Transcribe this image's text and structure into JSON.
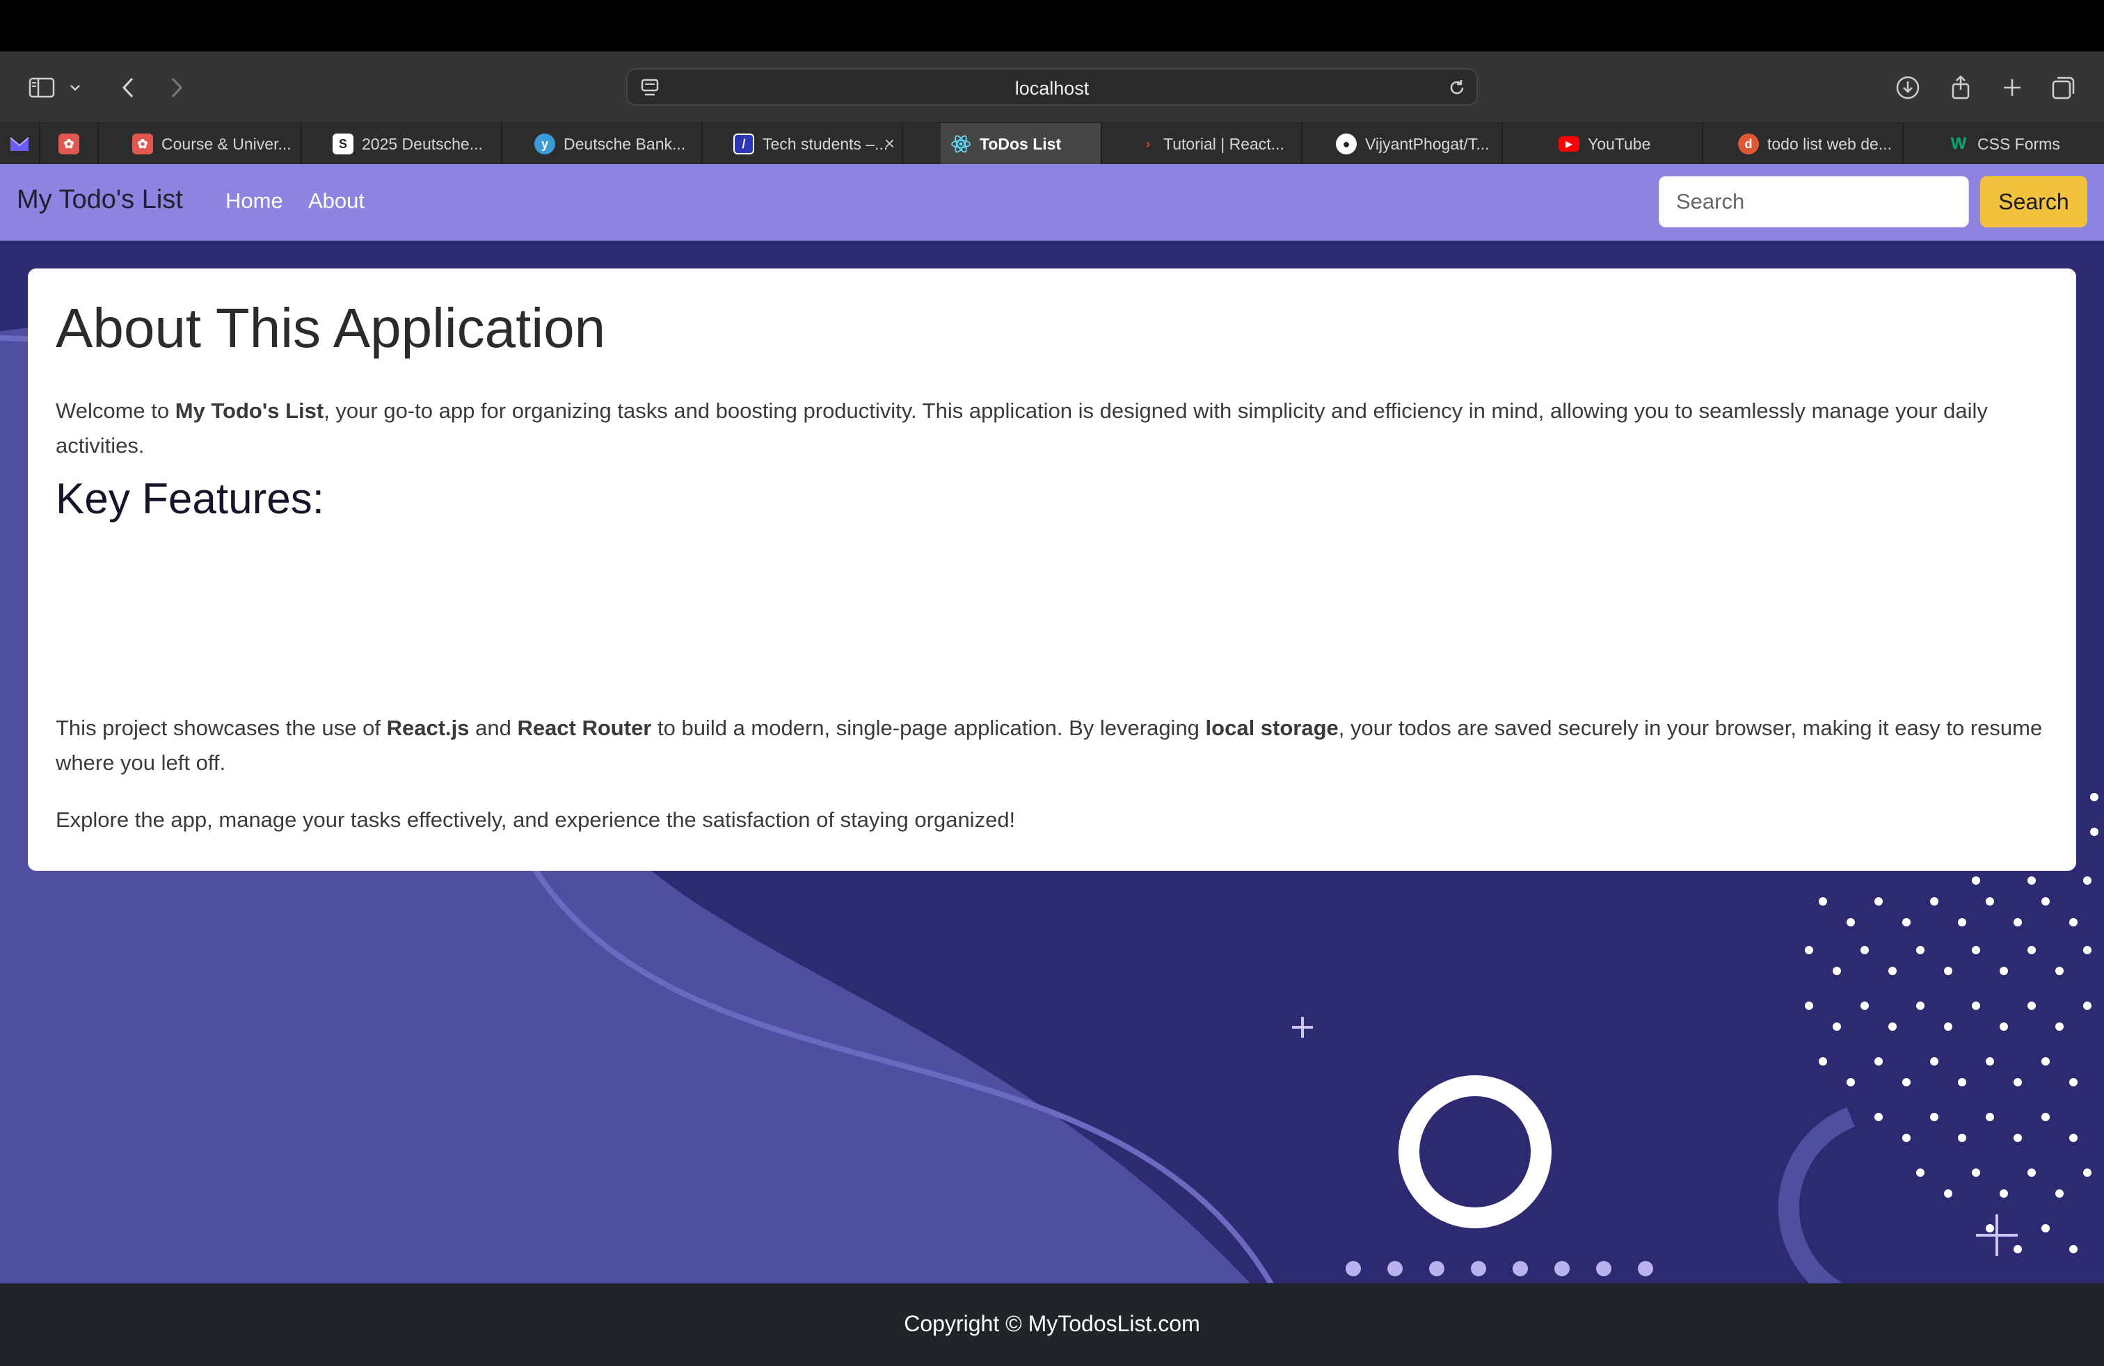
{
  "browser": {
    "url": "localhost",
    "tabs": [
      {
        "label": "",
        "favicon": "mail-icon",
        "color": "#6b5cff",
        "active": false
      },
      {
        "label": "",
        "favicon": "flower-icon",
        "color": "#e0584f",
        "active": false
      },
      {
        "label": "Course & Univer...",
        "favicon": "flower-icon",
        "color": "#e0584f",
        "active": false
      },
      {
        "label": "2025 Deutsche...",
        "favicon": "swirl-icon",
        "color": "#ffffff",
        "active": false
      },
      {
        "label": "Deutsche Bank...",
        "favicon": "bank-icon",
        "color": "#3a9bd9",
        "active": false
      },
      {
        "label": "Tech students –...",
        "favicon": "slash-box-icon",
        "color": "#2d36b8",
        "active": false
      },
      {
        "label": "ToDos List",
        "favicon": "react-icon",
        "color": "#61dafb",
        "active": true
      },
      {
        "label": "Tutorial | React...",
        "favicon": "chevron-right-icon",
        "color": "#e0463a",
        "active": false
      },
      {
        "label": "VijyantPhogat/T...",
        "favicon": "github-icon",
        "color": "#ffffff",
        "active": false
      },
      {
        "label": "YouTube",
        "favicon": "youtube-icon",
        "color": "#ff0000",
        "active": false
      },
      {
        "label": "todo list web de...",
        "favicon": "duckduckgo-icon",
        "color": "#de5833",
        "active": false
      },
      {
        "label": "CSS Forms",
        "favicon": "w3-icon",
        "color": "#04aa6d",
        "active": false
      }
    ]
  },
  "navbar": {
    "brand": "My Todo's List",
    "links": [
      "Home",
      "About"
    ],
    "search_placeholder": "Search",
    "search_button": "Search"
  },
  "about": {
    "title": "About This Application",
    "intro_prefix": "Welcome to ",
    "intro_bold": "My Todo's List",
    "intro_suffix": ", your go-to app for organizing tasks and boosting productivity. This application is designed with simplicity and efficiency in mind, allowing you to seamlessly manage your daily activities.",
    "features_title": "Key Features:",
    "tech_p1": "This project showcases the use of ",
    "tech_b1": "React.js",
    "tech_p2": " and ",
    "tech_b2": "React Router",
    "tech_p3": " to build a modern, single-page application. By leveraging ",
    "tech_b3": "local storage",
    "tech_p4": ", your todos are saved securely in your browser, making it easy to resume where you left off.",
    "closing": "Explore the app, manage your tasks effectively, and experience the satisfaction of staying organized!"
  },
  "footer": {
    "copyright": "Copyright © MyTodosList.com"
  },
  "colors": {
    "navbar": "#8c84e0",
    "search_button": "#f2c13d",
    "background": "#2e2a72",
    "footer": "#212529"
  }
}
